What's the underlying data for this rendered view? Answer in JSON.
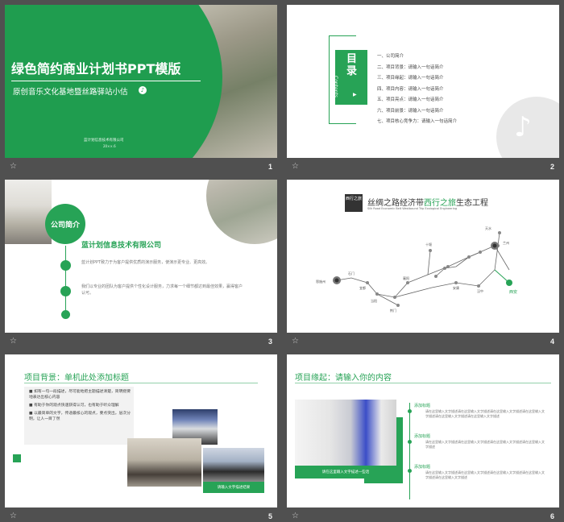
{
  "slides": [
    {
      "number": "1",
      "title": "绿色简约商业计划书PPT模版",
      "subtitle": "原创音乐文化基地暨丝路驿站小估",
      "company": "蓝计划信息技术有限公司",
      "date": "20××.6"
    },
    {
      "number": "2",
      "toc_title": "目录",
      "toc_en": "Contents",
      "items": [
        "一、公司简介",
        "二、项目背景：请输入一句话简介",
        "三、项目缘起：请输入一句话简介",
        "四、项目内容：请输入一句话简介",
        "五、项目亮点：请输入一句话简介",
        "六、项目前景：请输入一句话简介",
        "七、项目核心竞争力：请输入一句话简介"
      ]
    },
    {
      "number": "3",
      "badge": "公司简介",
      "company": "蓝计划信息技术有限公司",
      "para1": "蓝计划PPT致力于为客户提供优质的演示服务，使演示更专业、更高效。",
      "para2": "我们以专业的团队为客户提供个性化设计服务，力求每一个细节都达到最佳效果，赢得客户认可。"
    },
    {
      "number": "4",
      "seal": "西行之旅",
      "title_prefix": "丝绸之路经济带",
      "title_green": "西行之旅",
      "title_suffix": "生态工程",
      "title_en": "Silk Road Economic Belt Westbound Trip Ecological Engineering",
      "cities": [
        "恩施州",
        "石门",
        "宜都",
        "当阳",
        "荆门",
        "襄阳",
        "十堰",
        "安康",
        "汉中",
        "宝鸡",
        "天水",
        "兰州",
        "武威",
        "张掖",
        "嘉峪关",
        "敦煌",
        "哈密",
        "乌鲁木齐",
        "伊宁",
        "西安",
        "咸阳"
      ]
    },
    {
      "number": "5",
      "title": "项目背景：单机此处添加标题",
      "bullets": [
        "如有一句一段描述，尽可能地把主题描述清楚，简明扼要地表达出核心内容",
        "有助于你的观点快速获得认可，也有助于听众理解",
        "以最简单的文字，传递最核心的观点，要点突出，层次分明，让人一目了然"
      ],
      "caption": "请输入文字描述结果"
    },
    {
      "number": "6",
      "title": "项目缘起：请输入你的内容",
      "caption": "请在这里输入文字描述一些话",
      "sections": [
        {
          "head": "添加标题",
          "text": "请在这里输入文字描述请在这里输入文字描述请在这里输入文字描述请在这里输入文字描述请在这里输入文字描述请在这里输入文字描述"
        },
        {
          "head": "添加标题",
          "text": "请在这里输入文字描述请在这里输入文字描述请在这里输入文字描述请在这里输入文字描述"
        },
        {
          "head": "添加标题",
          "text": "请在这里输入文字描述请在这里输入文字描述请在这里输入文字描述请在这里输入文字描述请在这里输入文字描述"
        }
      ]
    }
  ]
}
